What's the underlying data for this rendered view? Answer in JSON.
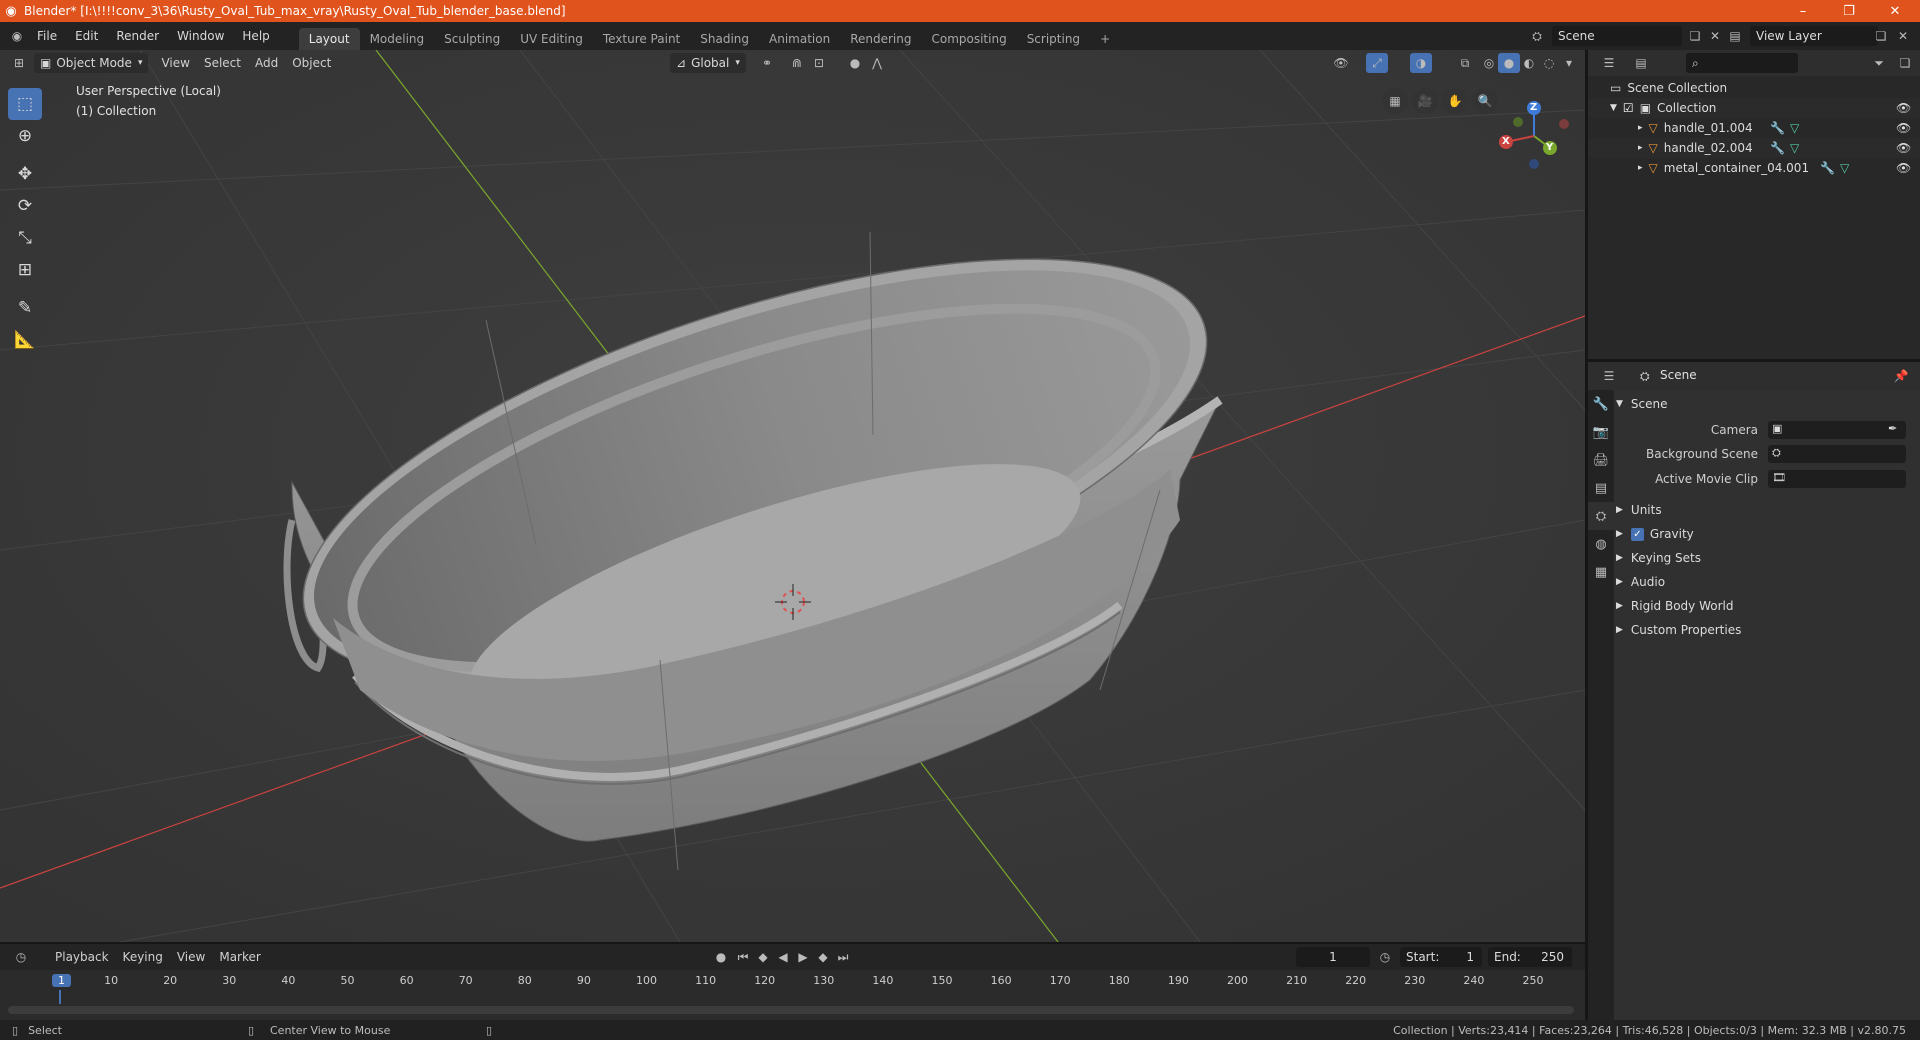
{
  "titlebar": {
    "title": "Blender* [I:\\!!!!conv_3\\36\\Rusty_Oval_Tub_max_vray\\Rusty_Oval_Tub_blender_base.blend]",
    "minimize": "–",
    "restore": "❐",
    "close": "✕"
  },
  "menu": [
    "File",
    "Edit",
    "Render",
    "Window",
    "Help"
  ],
  "workspaces": [
    "Layout",
    "Modeling",
    "Sculpting",
    "UV Editing",
    "Texture Paint",
    "Shading",
    "Animation",
    "Rendering",
    "Compositing",
    "Scripting"
  ],
  "workspace_add": "+",
  "scene_field": "Scene",
  "view_layer_field": "View Layer",
  "viewport": {
    "mode": "Object Mode",
    "menus": [
      "View",
      "Select",
      "Add",
      "Object"
    ],
    "transform_orientation": "Global",
    "overlay_line1": "User Perspective (Local)",
    "overlay_line2": "(1) Collection",
    "gizmo": {
      "x": "X",
      "y": "Y",
      "z": "Z"
    }
  },
  "outliner": {
    "root": "Scene Collection",
    "collection": "Collection",
    "objects": [
      "handle_01.004",
      "handle_02.004",
      "metal_container_04.001"
    ],
    "search_placeholder": ""
  },
  "properties": {
    "context": "Scene",
    "panel": "Scene",
    "fields": [
      {
        "label": "Camera",
        "value": ""
      },
      {
        "label": "Background Scene",
        "value": ""
      },
      {
        "label": "Active Movie Clip",
        "value": ""
      }
    ],
    "sections": [
      "Units",
      "Gravity",
      "Keying Sets",
      "Audio",
      "Rigid Body World",
      "Custom Properties"
    ],
    "gravity_checked": true
  },
  "timeline": {
    "menus": [
      "Playback",
      "Keying",
      "View",
      "Marker"
    ],
    "current_frame": "1",
    "start_label": "Start:",
    "start": "1",
    "end_label": "End:",
    "end": "250",
    "ticks": [
      "1",
      "10",
      "20",
      "30",
      "40",
      "50",
      "60",
      "70",
      "80",
      "90",
      "100",
      "110",
      "120",
      "130",
      "140",
      "150",
      "160",
      "170",
      "180",
      "190",
      "200",
      "210",
      "220",
      "230",
      "240",
      "250"
    ]
  },
  "statusbar": {
    "left_hint": "Select",
    "middle_hint": "Center View to Mouse",
    "stats": "Collection | Verts:23,414 | Faces:23,264 | Tris:46,528 | Objects:0/3 | Mem: 32.3 MB | v2.80.75"
  },
  "colors": {
    "titlebar": "#e0531d",
    "accent": "#4772b3",
    "x_axis": "#c9433f",
    "y_axis": "#7aa82c",
    "z_axis": "#3f7bd9",
    "viewport_bg": "#3a3a3a"
  }
}
